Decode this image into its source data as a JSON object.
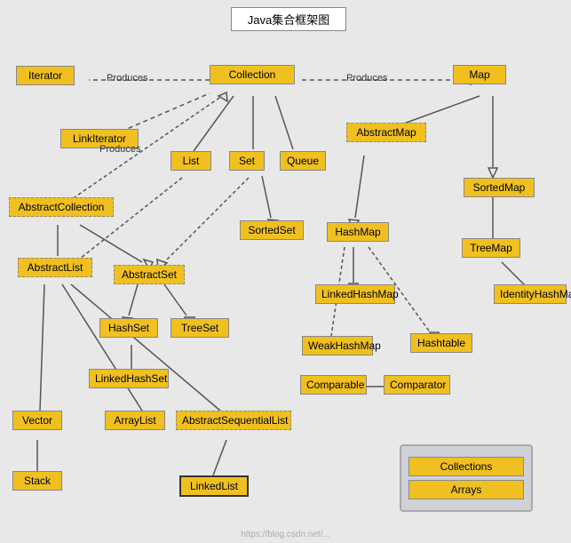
{
  "title": "Java集合框架图",
  "nodes": {
    "title": "Java集合框架图",
    "iterator": "Iterator",
    "collection": "Collection",
    "map": "Map",
    "linkIterator": "LinkIterator",
    "list": "List",
    "set": "Set",
    "queue": "Queue",
    "abstractMap": "AbstractMap",
    "sortedMap": "SortedMap",
    "abstractCollection": "AbstractCollection",
    "abstractList": "AbstractList",
    "abstractSet": "AbstractSet",
    "sortedSet": "SortedSet",
    "hashMap": "HashMap",
    "treeMap": "TreeMap",
    "identityHashMap": "IdentityHashMap",
    "linkedHashMap": "LinkedHashMap",
    "hashtable": "Hashtable",
    "hashSet": "HashSet",
    "treeSet": "TreeSet",
    "weakHashMap": "WeakHashMap",
    "comparable": "Comparable",
    "comparator": "Comparator",
    "linkedHashSet": "LinkedHashSet",
    "vector": "Vector",
    "arrayList": "ArrayList",
    "abstractSequentialList": "AbstractSequentialList",
    "stack": "Stack",
    "linkedList": "LinkedList",
    "collections": "Collections",
    "arrays": "Arrays",
    "produces1": "Produces",
    "produces2": "Produces",
    "produces3": "Produces"
  }
}
